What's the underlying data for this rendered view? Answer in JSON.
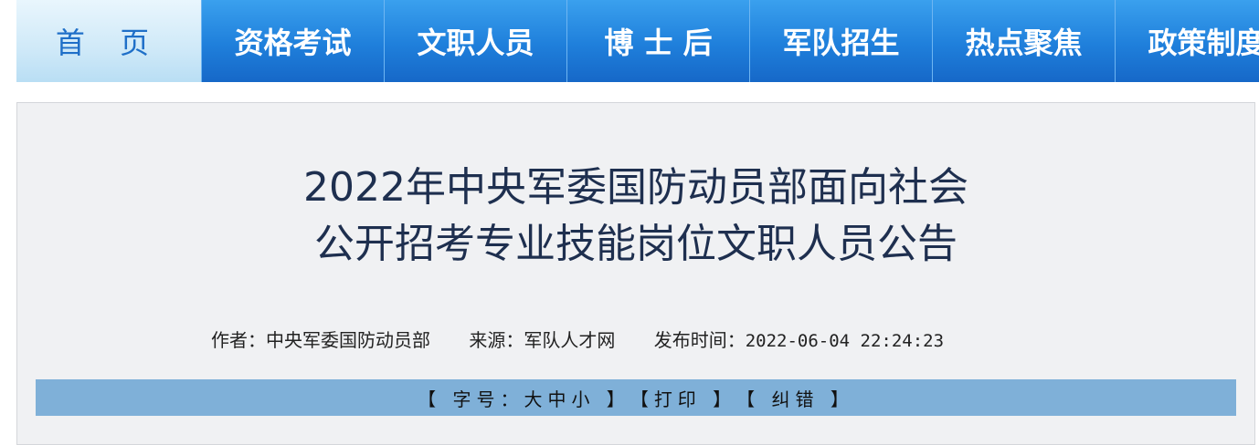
{
  "nav": {
    "items": [
      "首 页",
      "资格考试",
      "文职人员",
      "博 士 后",
      "军队招生",
      "热点聚焦",
      "政策制度"
    ]
  },
  "article": {
    "title_line1": "2022年中央军委国防动员部面向社会",
    "title_line2": "公开招考专业技能岗位文职人员公告",
    "author": "作者：中央军委国防动员部",
    "source": "来源：军队人才网",
    "publish_label": "发布时间：",
    "publish_time": "2022-06-04 22:24:23"
  },
  "toolbar": {
    "open1": "【 ",
    "font_label": "字号：",
    "size_large": "大",
    "size_medium": "中",
    "size_small": "小",
    "close1": " 】",
    "open2": "【",
    "print": "打印",
    "close2": " 】",
    "open3": "【 ",
    "correct": "纠错",
    "close3": " 】"
  },
  "colors": {
    "nav_blue": "#1f7fdb",
    "home_tab": "#cfe9f8",
    "title_text": "#1e2f4f",
    "toolbar_bg": "#7fb0d8"
  }
}
